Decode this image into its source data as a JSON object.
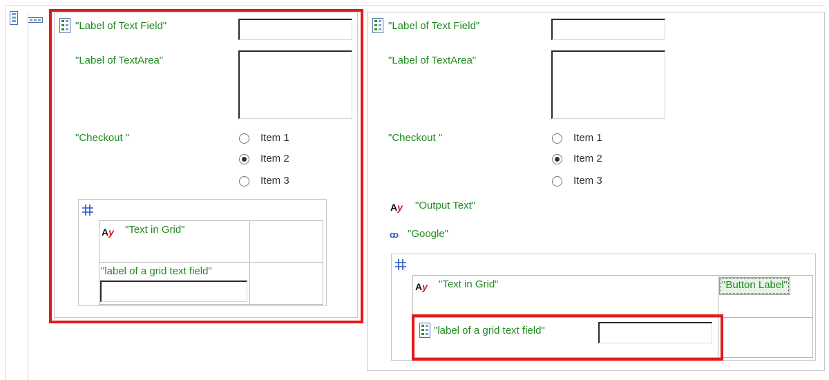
{
  "left_form": {
    "text_field_label": "\"Label of Text Field\"",
    "text_area_label": "\"Label of TextArea\"",
    "checkout_label": "\"Checkout \"",
    "radio_items": [
      "Item 1",
      "Item 2",
      "Item 3"
    ],
    "selected_radio": "Item 2",
    "grid": {
      "output_text": "\"Text in Grid\"",
      "text_field_label": "\"label of a grid text field\""
    }
  },
  "right_form": {
    "text_field_label": "\"Label of Text Field\"",
    "text_area_label": "\"Label of TextArea\"",
    "checkout_label": "\"Checkout \"",
    "radio_items": [
      "Item 1",
      "Item 2",
      "Item 3"
    ],
    "selected_radio": "Item 2",
    "output_text": "\"Output Text\"",
    "link_text": "\"Google\"",
    "grid": {
      "output_text": "\"Text in Grid\"",
      "button_label": "\"Button Label\"",
      "text_field_label": "\"label of a grid text field\""
    }
  },
  "icons": {
    "form": "form-layout-icon",
    "panel": "panel-group-icon",
    "grid": "grid-hash-icon",
    "output": "output-text-icon",
    "link": "hyperlink-icon"
  },
  "colors": {
    "label_green": "#1e8a1e",
    "highlight_red": "#e01b1b",
    "output_icon_red": "#d11111",
    "link_icon_blue": "#2456c8"
  }
}
